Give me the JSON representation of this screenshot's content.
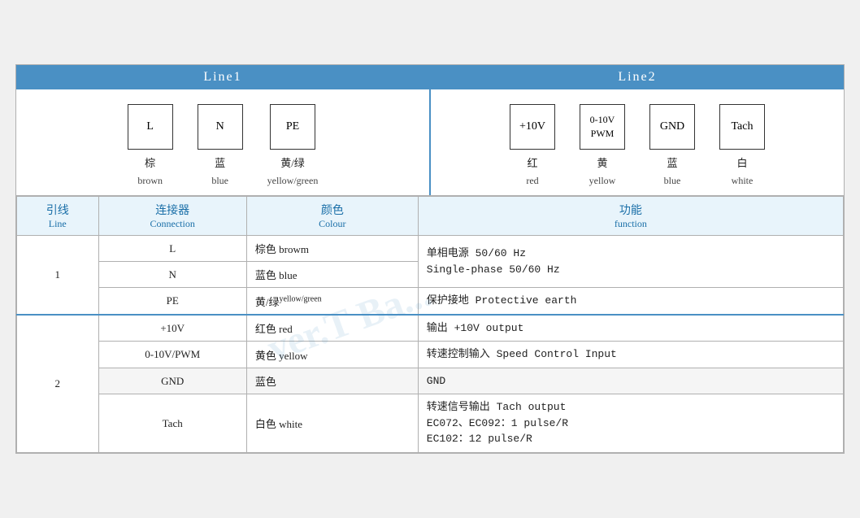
{
  "line1": {
    "header": "Line1",
    "connectors": [
      {
        "label": "L",
        "zh": "棕",
        "en": "brown"
      },
      {
        "label": "N",
        "zh": "蓝",
        "en": "blue"
      },
      {
        "label": "PE",
        "zh": "黄/绿",
        "en": "yellow/green"
      }
    ]
  },
  "line2": {
    "header": "Line2",
    "connectors": [
      {
        "label": "+10V",
        "zh": "红",
        "en": "red"
      },
      {
        "label1": "0-10V",
        "label2": "PWM",
        "zh": "黄",
        "en": "yellow",
        "twoLine": true
      },
      {
        "label": "GND",
        "zh": "蓝",
        "en": "blue"
      },
      {
        "label": "Tach",
        "zh": "白",
        "en": "white"
      }
    ]
  },
  "table": {
    "headers": [
      {
        "zh": "引线",
        "en": "Line"
      },
      {
        "zh": "连接器",
        "en": "Connection"
      },
      {
        "zh": "颜色",
        "en": "Colour"
      },
      {
        "zh": "功能",
        "en": "function"
      }
    ],
    "rows": [
      {
        "line": "1",
        "lineRowspan": 3,
        "entries": [
          {
            "conn": "L",
            "color_zh": "棕色",
            "color_en": "browm",
            "func": "单相电源 50/60 Hz\nSingle-phase 50/60 Hz",
            "funcRowspan": 2
          },
          {
            "conn": "N",
            "color_zh": "蓝色",
            "color_en": "blue",
            "mergedFunc": true
          },
          {
            "conn": "PE",
            "color_zh": "黄/绿",
            "color_en_sub": "yellow/green",
            "func": "保护接地 Protective earth"
          }
        ]
      },
      {
        "line": "2",
        "lineRowspan": 4,
        "entries": [
          {
            "conn": "+10V",
            "color_zh": "红色",
            "color_en": "red",
            "func": "输出 +10V output"
          },
          {
            "conn": "0-10V/PWM",
            "color_zh": "黄色",
            "color_en": "yellow",
            "func": "转速控制输入 Speed Control Input",
            "gnd": false
          },
          {
            "conn": "GND",
            "color_zh": "蓝色",
            "color_en": "",
            "func": "GND",
            "isGnd": true
          },
          {
            "conn": "Tach",
            "color_zh": "白色",
            "color_en": "white",
            "func": "转速信号输出 Tach output\nEC072、EC092：1 pulse/R\nEC102：12 pulse/R"
          }
        ]
      }
    ]
  },
  "watermark": "ver.T Ba..."
}
